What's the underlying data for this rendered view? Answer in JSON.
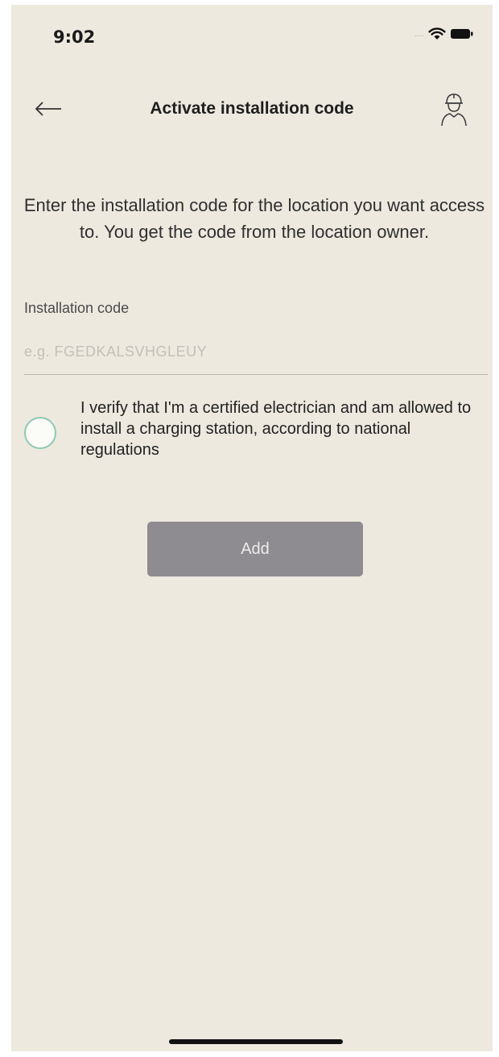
{
  "status_bar": {
    "time": "9:02",
    "signal_text": "·····",
    "icons": [
      "wifi-icon",
      "battery-icon"
    ]
  },
  "nav": {
    "back_icon": "arrow-left-icon",
    "title": "Activate installation code",
    "installer_icon": "installer-person-icon"
  },
  "instruction": "Enter the installation code for the location you want access to. You get the code from the location owner.",
  "installation_code": {
    "label": "Installation code",
    "placeholder": "e.g. FGEDKALSVHGLEUY",
    "value": ""
  },
  "verification": {
    "text": "I verify that I'm a certified electrician and am allowed to install a charging station, according to national regulations",
    "checked": false
  },
  "add_button": {
    "label": "Add",
    "enabled": false
  },
  "colors": {
    "background": "#ede9df",
    "button_disabled": "#8e8c90",
    "radio_border": "#8ec9b3",
    "text": "#2b2b2b"
  }
}
